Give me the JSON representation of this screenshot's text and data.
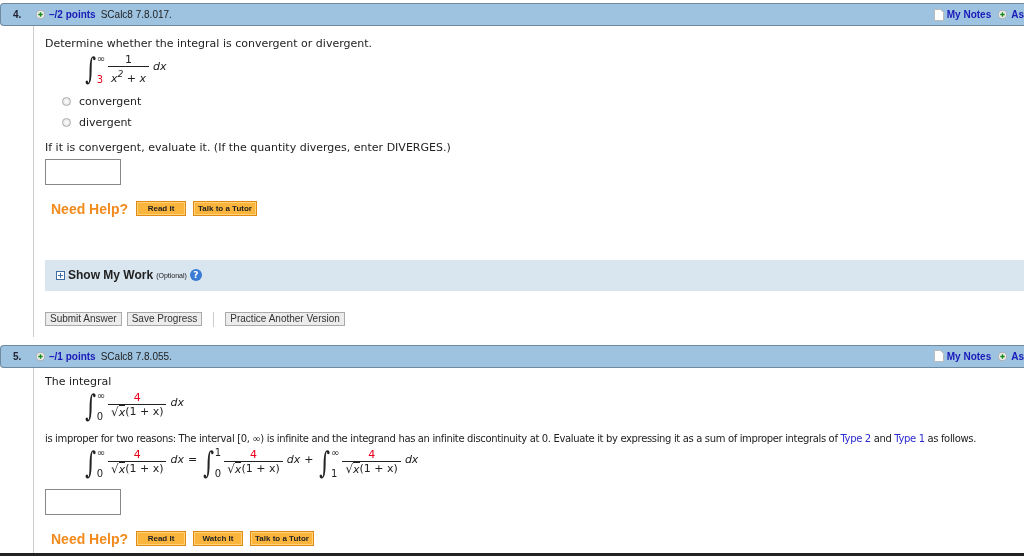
{
  "questions": [
    {
      "number": "4.",
      "points": "–/2 points",
      "code": "SCalc8 7.8.017.",
      "notes": "My Notes",
      "ask": "As",
      "body": [
        {
          "kind": "text",
          "text": "Determine whether the integral is convergent or divergent."
        },
        {
          "kind": "equation",
          "terms": [
            {
              "kind": "integral",
              "sign": "∫",
              "upper": {
                "text": "∞"
              },
              "lower": {
                "text": "3",
                "color": "#e8001c"
              },
              "numerator": {
                "text": "1"
              },
              "denominator": "x$^{2}$ + x",
              "differential": "dx"
            }
          ]
        },
        {
          "kind": "radios",
          "options": [
            {
              "label": "convergent",
              "selected": false
            },
            {
              "label": "divergent",
              "selected": false
            }
          ]
        },
        {
          "kind": "text",
          "text": "If it is convergent, evaluate it. (If the quantity diverges, enter DIVERGES.)"
        },
        {
          "kind": "answer"
        },
        {
          "kind": "help",
          "label": "Need Help?",
          "buttons": [
            "Read It",
            "Talk to a Tutor"
          ]
        },
        {
          "kind": "work",
          "title": "Show My Work",
          "note": "(Optional)",
          "help_icon": "?"
        },
        {
          "kind": "actions",
          "buttons": [
            "Submit Answer",
            "Save Progress"
          ],
          "extra": "Practice Another Version"
        }
      ]
    },
    {
      "number": "5.",
      "points": "–/1 points",
      "code": "SCalc8 7.8.055.",
      "notes": "My Notes",
      "ask": "As",
      "body": [
        {
          "kind": "text",
          "text": "The integral"
        },
        {
          "kind": "equation",
          "terms": [
            {
              "kind": "integral",
              "sign": "∫",
              "upper": {
                "text": "∞"
              },
              "lower": {
                "text": "0"
              },
              "numerator": {
                "text": "4",
                "color": "#e8001c"
              },
              "radical": "√",
              "radicand": "x",
              "denominator": "(1 + x)",
              "differential": "dx"
            }
          ]
        },
        {
          "kind": "sentence",
          "parts": [
            {
              "kind": "text",
              "text": "is improper for two reasons: The interval [0, ∞) is infinite and the integrand has an infinite discontinuity at 0. Evaluate it by expressing it as a sum of improper integrals of "
            },
            {
              "kind": "link",
              "text": "Type 2"
            },
            {
              "kind": "text",
              "text": " and "
            },
            {
              "kind": "link",
              "text": "Type 1"
            },
            {
              "kind": "text",
              "text": " as follows."
            }
          ]
        },
        {
          "kind": "equation",
          "terms": [
            {
              "kind": "integral",
              "sign": "∫",
              "upper": {
                "text": "∞"
              },
              "lower": {
                "text": "0"
              },
              "numerator": {
                "text": "4",
                "color": "#e8001c"
              },
              "radical": "√",
              "radicand": "x",
              "denominator": "(1 + x)",
              "differential": "dx"
            },
            {
              "kind": "operator",
              "text": "="
            },
            {
              "kind": "integral",
              "sign": "∫",
              "upper": {
                "text": "1"
              },
              "lower": {
                "text": "0"
              },
              "numerator": {
                "text": "4",
                "color": "#e8001c"
              },
              "radical": "√",
              "radicand": "x",
              "denominator": "(1 + x)",
              "differential": "dx"
            },
            {
              "kind": "operator",
              "text": "+"
            },
            {
              "kind": "integral",
              "sign": "∫",
              "upper": {
                "text": "∞"
              },
              "lower": {
                "text": "1"
              },
              "numerator": {
                "text": "4",
                "color": "#e8001c"
              },
              "radical": "√",
              "radicand": "x",
              "denominator": "(1 + x)",
              "differential": "dx"
            }
          ]
        },
        {
          "kind": "answer"
        },
        {
          "kind": "help",
          "label": "Need Help?",
          "buttons": [
            "Read It",
            "Watch It",
            "Talk to a Tutor"
          ]
        }
      ]
    }
  ]
}
